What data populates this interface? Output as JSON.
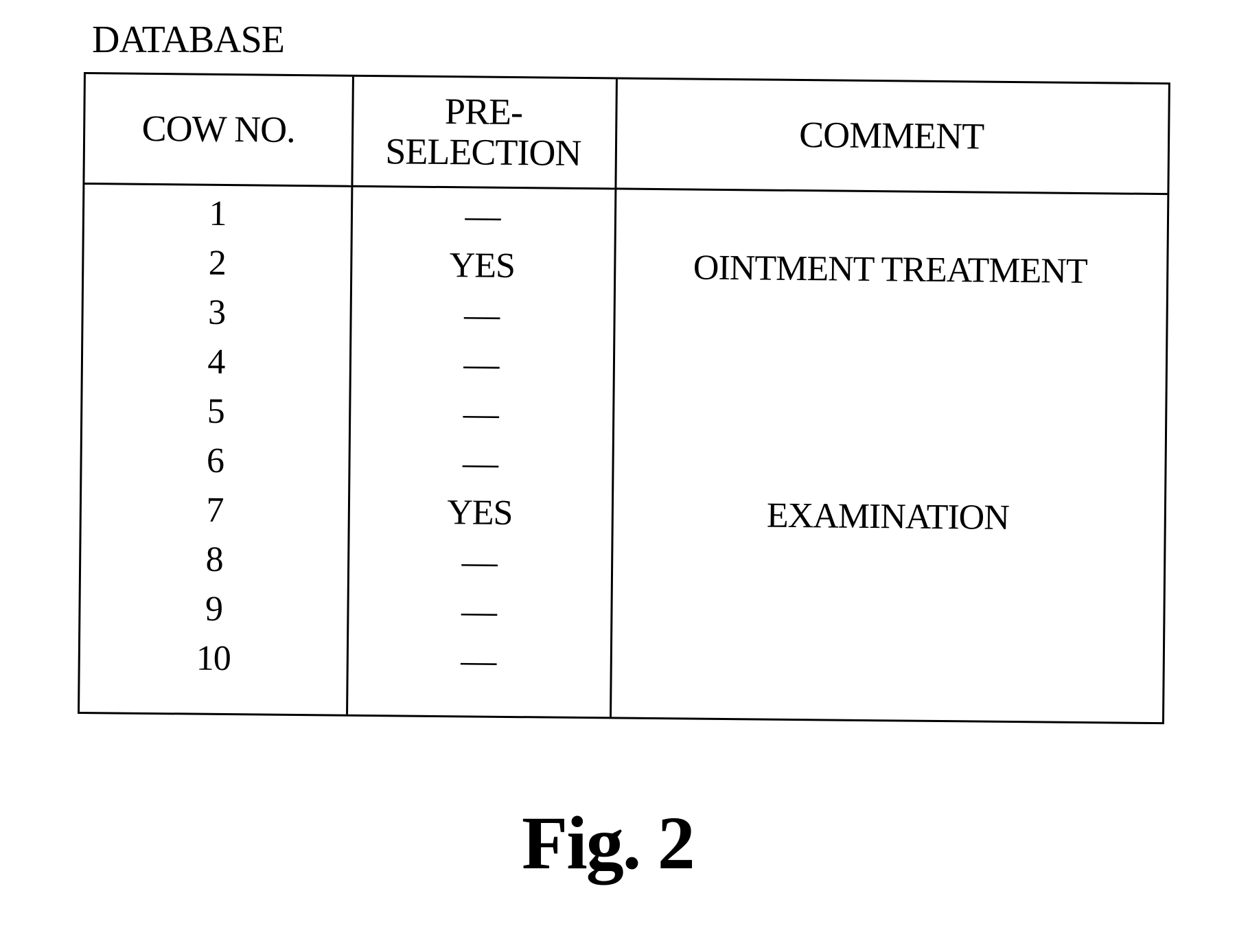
{
  "title": "DATABASE",
  "table": {
    "headers": [
      "COW NO.",
      "PRE-\nSELECTION",
      "COMMENT"
    ],
    "rows": [
      {
        "cow_no": "1",
        "preselection": "—",
        "comment": ""
      },
      {
        "cow_no": "2",
        "preselection": "YES",
        "comment": "OINTMENT TREATMENT"
      },
      {
        "cow_no": "3",
        "preselection": "—",
        "comment": ""
      },
      {
        "cow_no": "4",
        "preselection": "—",
        "comment": ""
      },
      {
        "cow_no": "5",
        "preselection": "—",
        "comment": ""
      },
      {
        "cow_no": "6",
        "preselection": "—",
        "comment": ""
      },
      {
        "cow_no": "7",
        "preselection": "YES",
        "comment": "EXAMINATION"
      },
      {
        "cow_no": "8",
        "preselection": "—",
        "comment": ""
      },
      {
        "cow_no": "9",
        "preselection": "—",
        "comment": ""
      },
      {
        "cow_no": "10",
        "preselection": "—",
        "comment": ""
      }
    ]
  },
  "caption": "Fig. 2"
}
